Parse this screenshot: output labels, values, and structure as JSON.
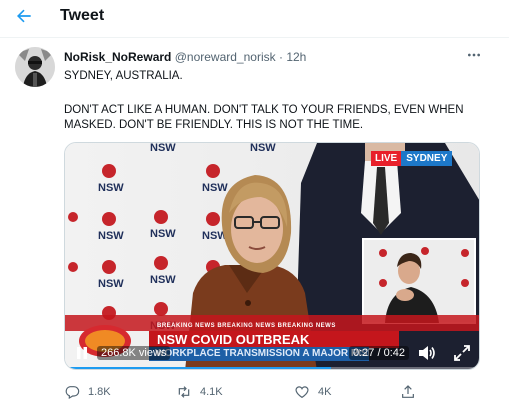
{
  "header": {
    "title": "Tweet"
  },
  "tweet": {
    "name": "NoRisk_NoReward",
    "handle": "@noreward_norisk",
    "separator": "·",
    "time": "12h",
    "line1": "SYDNEY, AUSTRALIA.",
    "line2": "DON'T ACT LIKE A HUMAN. DON'T TALK TO YOUR FRIENDS, EVEN WHEN MASKED. DON'T BE FRIENDLY. THIS IS NOT THE TIME."
  },
  "video": {
    "live_label": "LIVE",
    "location_label": "SYDNEY",
    "backdrop_text": "NSW",
    "breaking_text": "BREAKING NEWS   BREAKING NEWS   BREAKING NEWS",
    "headline": "NSW COVID OUTBREAK",
    "subheadline": "WORKPLACE TRANSMISSION A MAJOR RISK",
    "views": "266.8K views",
    "time": "0:27 / 0:42",
    "progress_fraction": 0.64
  },
  "actions": {
    "replies": "1.8K",
    "retweets": "4.1K",
    "likes": "4K"
  },
  "icons": {
    "back": "back-arrow-icon",
    "more": "more-icon",
    "reply": "reply-icon",
    "retweet": "retweet-icon",
    "like": "heart-icon",
    "share": "share-icon"
  },
  "colors": {
    "accent": "#1d9bf0",
    "banner_red": "#c4161c",
    "banner_blue": "#1d5fa6"
  }
}
